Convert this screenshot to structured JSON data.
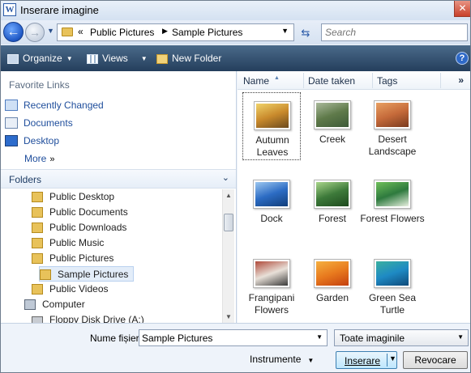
{
  "window": {
    "title": "Inserare imagine",
    "app_icon_letter": "W",
    "close_glyph": "✕"
  },
  "nav": {
    "back_glyph": "←",
    "forward_glyph": "→",
    "chevron": "«",
    "breadcrumb": [
      "Public Pictures",
      "Sample Pictures"
    ],
    "crumb_separator": "▶",
    "search_placeholder": "Search"
  },
  "toolbar": {
    "organize": "Organize",
    "views": "Views",
    "new_folder": "New Folder",
    "help": "?"
  },
  "navpane": {
    "favorites_header": "Favorite Links",
    "favorites": [
      "Recently Changed",
      "Documents",
      "Desktop"
    ],
    "more": "More",
    "folders_header": "Folders",
    "tree": [
      "Public Desktop",
      "Public Documents",
      "Public Downloads",
      "Public Music",
      "Public Pictures",
      "Sample Pictures",
      "Public Videos",
      "Computer",
      "Floppy Disk Drive (A:)"
    ]
  },
  "filelist": {
    "columns": [
      "Name",
      "Date taken",
      "Tags"
    ],
    "more": "»",
    "files": [
      {
        "name": "Autumn Leaves",
        "colors": [
          "#c98a2c",
          "#f0d36a",
          "#6b4a1e"
        ]
      },
      {
        "name": "Creek",
        "colors": [
          "#5f7a4a",
          "#a9b99a",
          "#3d5a38"
        ]
      },
      {
        "name": "Desert Landscape",
        "colors": [
          "#c56a3a",
          "#e8a062",
          "#7a3a1e"
        ]
      },
      {
        "name": "Dock",
        "colors": [
          "#2c6cc4",
          "#9cc7f0",
          "#123e7a"
        ]
      },
      {
        "name": "Forest",
        "colors": [
          "#3d7a3a",
          "#a8d58a",
          "#1e4a1e"
        ]
      },
      {
        "name": "Forest Flowers",
        "colors": [
          "#2e7a3e",
          "#6fbf5a",
          "#e8f0e0"
        ]
      },
      {
        "name": "Frangipani Flowers",
        "colors": [
          "#e8e0d8",
          "#b04a3a",
          "#3a3a3a"
        ]
      },
      {
        "name": "Garden",
        "colors": [
          "#e87a1e",
          "#f5b040",
          "#c4400e"
        ]
      },
      {
        "name": "Green Sea Turtle",
        "colors": [
          "#1e8ac4",
          "#3ab0a0",
          "#0e4a7a"
        ]
      }
    ]
  },
  "bottom": {
    "filename_label": "Nume fișier:",
    "filename_value": "Sample Pictures",
    "filetype_value": "Toate imaginile",
    "tools": "Instrumente",
    "insert": "Inserare",
    "cancel": "Revocare"
  }
}
